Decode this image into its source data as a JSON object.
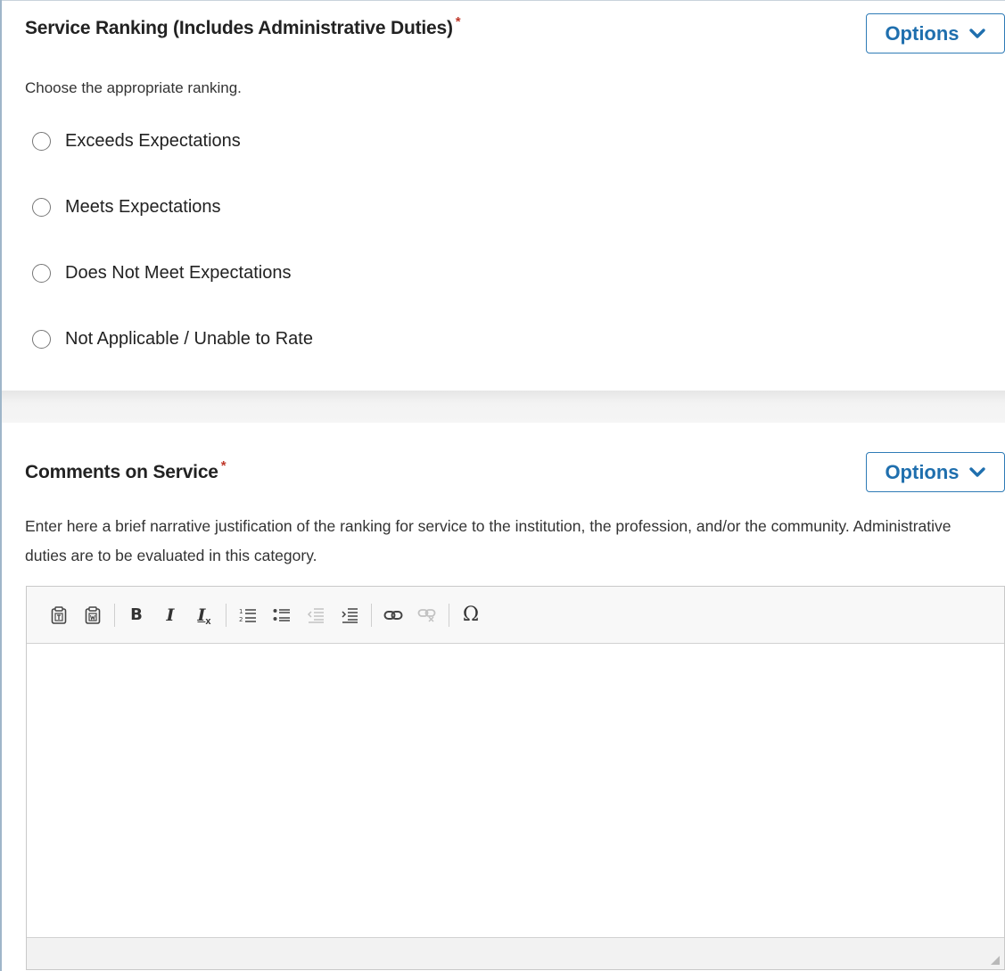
{
  "ranking": {
    "title": "Service Ranking (Includes Administrative Duties)",
    "required_mark": "*",
    "options_label": "Options",
    "instructions": "Choose the appropriate ranking.",
    "choices": [
      {
        "label": "Exceeds Expectations",
        "selected": false
      },
      {
        "label": "Meets Expectations",
        "selected": false
      },
      {
        "label": "Does Not Meet Expectations",
        "selected": false
      },
      {
        "label": "Not Applicable / Unable to Rate",
        "selected": false
      }
    ]
  },
  "comments": {
    "title": "Comments on Service",
    "required_mark": "*",
    "options_label": "Options",
    "instructions": "Enter here a brief narrative justification of the ranking for service to the institution, the profession, and/or the community.  Administrative duties are to be evaluated in this category.",
    "editor": {
      "value": "",
      "toolbar": {
        "bold_glyph": "B",
        "italic_glyph": "I",
        "remove_format_glyph": "I",
        "special_char_glyph": "Ω",
        "icons": [
          "paste-text-icon",
          "paste-word-icon",
          "bold-icon",
          "italic-icon",
          "remove-format-icon",
          "numbered-list-icon",
          "bulleted-list-icon",
          "outdent-icon",
          "indent-icon",
          "link-icon",
          "unlink-icon",
          "special-character-icon"
        ],
        "disabled": [
          "outdent-icon",
          "unlink-icon"
        ]
      }
    }
  },
  "colors": {
    "accent": "#1f6fae",
    "required": "#c0392b",
    "disabled_icon": "#bdbdbd"
  }
}
